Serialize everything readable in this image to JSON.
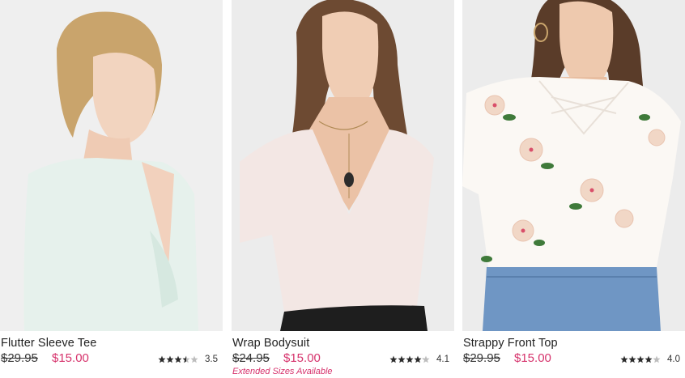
{
  "products": [
    {
      "name": "Flutter Sleeve Tee",
      "original_price": "$29.95",
      "sale_price": "$15.00",
      "rating": "3.5",
      "rating_stars": 3.5,
      "extended_sizes": ""
    },
    {
      "name": "Wrap Bodysuit",
      "original_price": "$24.95",
      "sale_price": "$15.00",
      "rating": "4.1",
      "rating_stars": 4.1,
      "extended_sizes": "Extended Sizes Available"
    },
    {
      "name": "Strappy Front Top",
      "original_price": "$29.95",
      "sale_price": "$15.00",
      "rating": "4.0",
      "rating_stars": 4.0,
      "extended_sizes": ""
    }
  ],
  "colors": {
    "sale": "#d6336c",
    "star_filled": "#2b2b2b",
    "star_empty": "#bdbdbd",
    "photo_bg": "#ededed"
  }
}
